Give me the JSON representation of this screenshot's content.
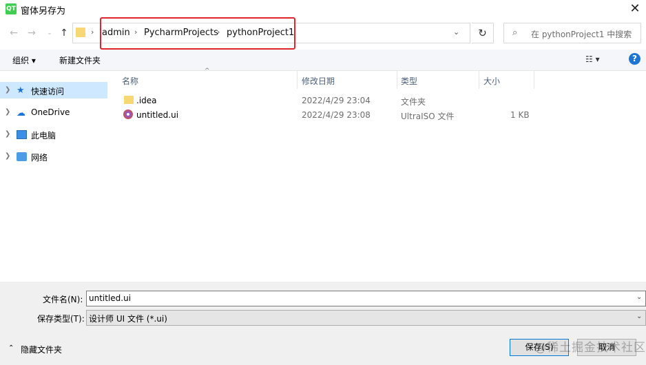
{
  "window": {
    "title": "窗体另存为",
    "app_icon": "QT"
  },
  "nav": {
    "breadcrumbs": [
      "admin",
      "PycharmProjects",
      "pythonProject1"
    ],
    "search_placeholder": "在 pythonProject1 中搜索"
  },
  "toolbar": {
    "organize": "组织 ▾",
    "new_folder": "新建文件夹"
  },
  "sidebar": {
    "items": [
      {
        "label": "快速访问",
        "icon": "star-icon",
        "selected": true
      },
      {
        "label": "OneDrive",
        "icon": "cloud-icon"
      },
      {
        "label": "此电脑",
        "icon": "computer-icon"
      },
      {
        "label": "网络",
        "icon": "network-icon"
      }
    ]
  },
  "columns": {
    "name": "名称",
    "date": "修改日期",
    "type": "类型",
    "size": "大小"
  },
  "files": [
    {
      "name": ".idea",
      "date": "2022/4/29 23:04",
      "type": "文件夹",
      "size": "",
      "icon": "folder-icon"
    },
    {
      "name": "untitled.ui",
      "date": "2022/4/29 23:08",
      "type": "UltraISO 文件",
      "size": "1 KB",
      "icon": "disc-file-icon"
    }
  ],
  "form": {
    "filename_label": "文件名(N):",
    "filename_value": "untitled.ui",
    "filetype_label": "保存类型(T):",
    "filetype_value": "设计师 UI 文件 (*.ui)"
  },
  "footer": {
    "hide_folders": "隐藏文件夹",
    "save": "保存(S)",
    "cancel": "取消",
    "watermark": "@稀土掘金技术社区"
  },
  "colors": {
    "accent": "#0078d7",
    "highlight_box": "#e0242a",
    "selected_bg": "#cde8ff",
    "folder": "#f8d775"
  }
}
